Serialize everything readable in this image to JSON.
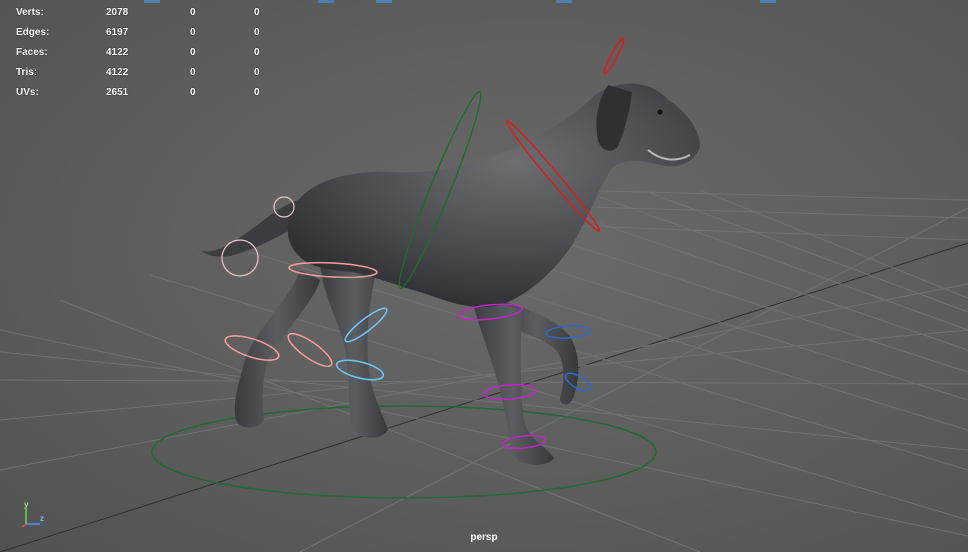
{
  "viewport": {
    "camera_name": "persp"
  },
  "stats": [
    {
      "label": "Verts:",
      "total": "2078",
      "selected": "0",
      "selected_2": "0"
    },
    {
      "label": "Edges:",
      "total": "6197",
      "selected": "0",
      "selected_2": "0"
    },
    {
      "label": "Faces:",
      "total": "4122",
      "selected": "0",
      "selected_2": "0"
    },
    {
      "label": "Tris:",
      "total": "4122",
      "selected": "0",
      "selected_2": "0"
    },
    {
      "label": "UVs:",
      "total": "2651",
      "selected": "0",
      "selected_2": "0"
    }
  ],
  "axis": {
    "y_label": "y",
    "z_label": "z"
  },
  "colors": {
    "viewport_bg": "#5d5d5d",
    "grid": "#6f6f6f",
    "grid_dark": "#3a3a3a",
    "hud_text": "#ffffff",
    "root_control": "#1f6b2e",
    "spine_control": "#1f6b2e",
    "neck_control": "#d91e1e",
    "left_leg_control": "#ff9d9d",
    "right_leg_control": "#6fc6ff",
    "front_leg_control": "#c026c8",
    "front_leg_alt_control": "#2f69c9"
  },
  "model": {
    "subject": "dog"
  }
}
